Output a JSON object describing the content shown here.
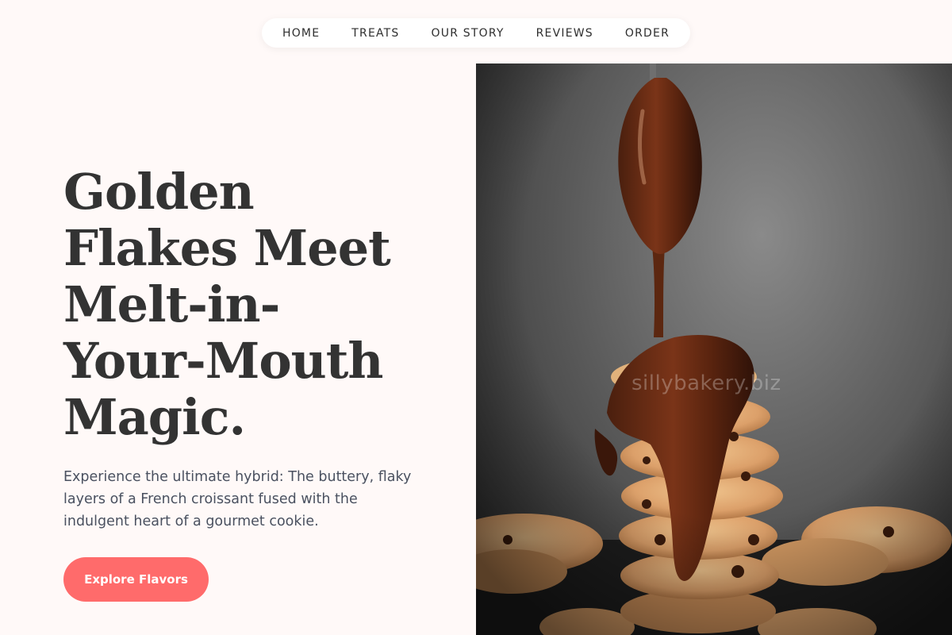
{
  "nav": {
    "items": [
      {
        "label": "HOME"
      },
      {
        "label": "TREATS"
      },
      {
        "label": "OUR STORY"
      },
      {
        "label": "REVIEWS"
      },
      {
        "label": "ORDER"
      }
    ]
  },
  "hero": {
    "title_lines": [
      "Golden",
      "Flakes Meet",
      "Melt-in-",
      "Your-Mouth",
      "Magic."
    ],
    "description": "Experience the ultimate hybrid: The buttery, flaky layers of a French croissant fused with the indulgent heart of a gourmet cookie.",
    "cta_label": "Explore Flavors"
  },
  "image": {
    "subject": "stacked cookies with chocolate drizzled from a spoon",
    "watermark": "sillybakery.biz"
  },
  "colors": {
    "background": "#fff9f8",
    "accent": "#ff6b6b",
    "heading": "#333333",
    "body_text": "#4a5160"
  }
}
